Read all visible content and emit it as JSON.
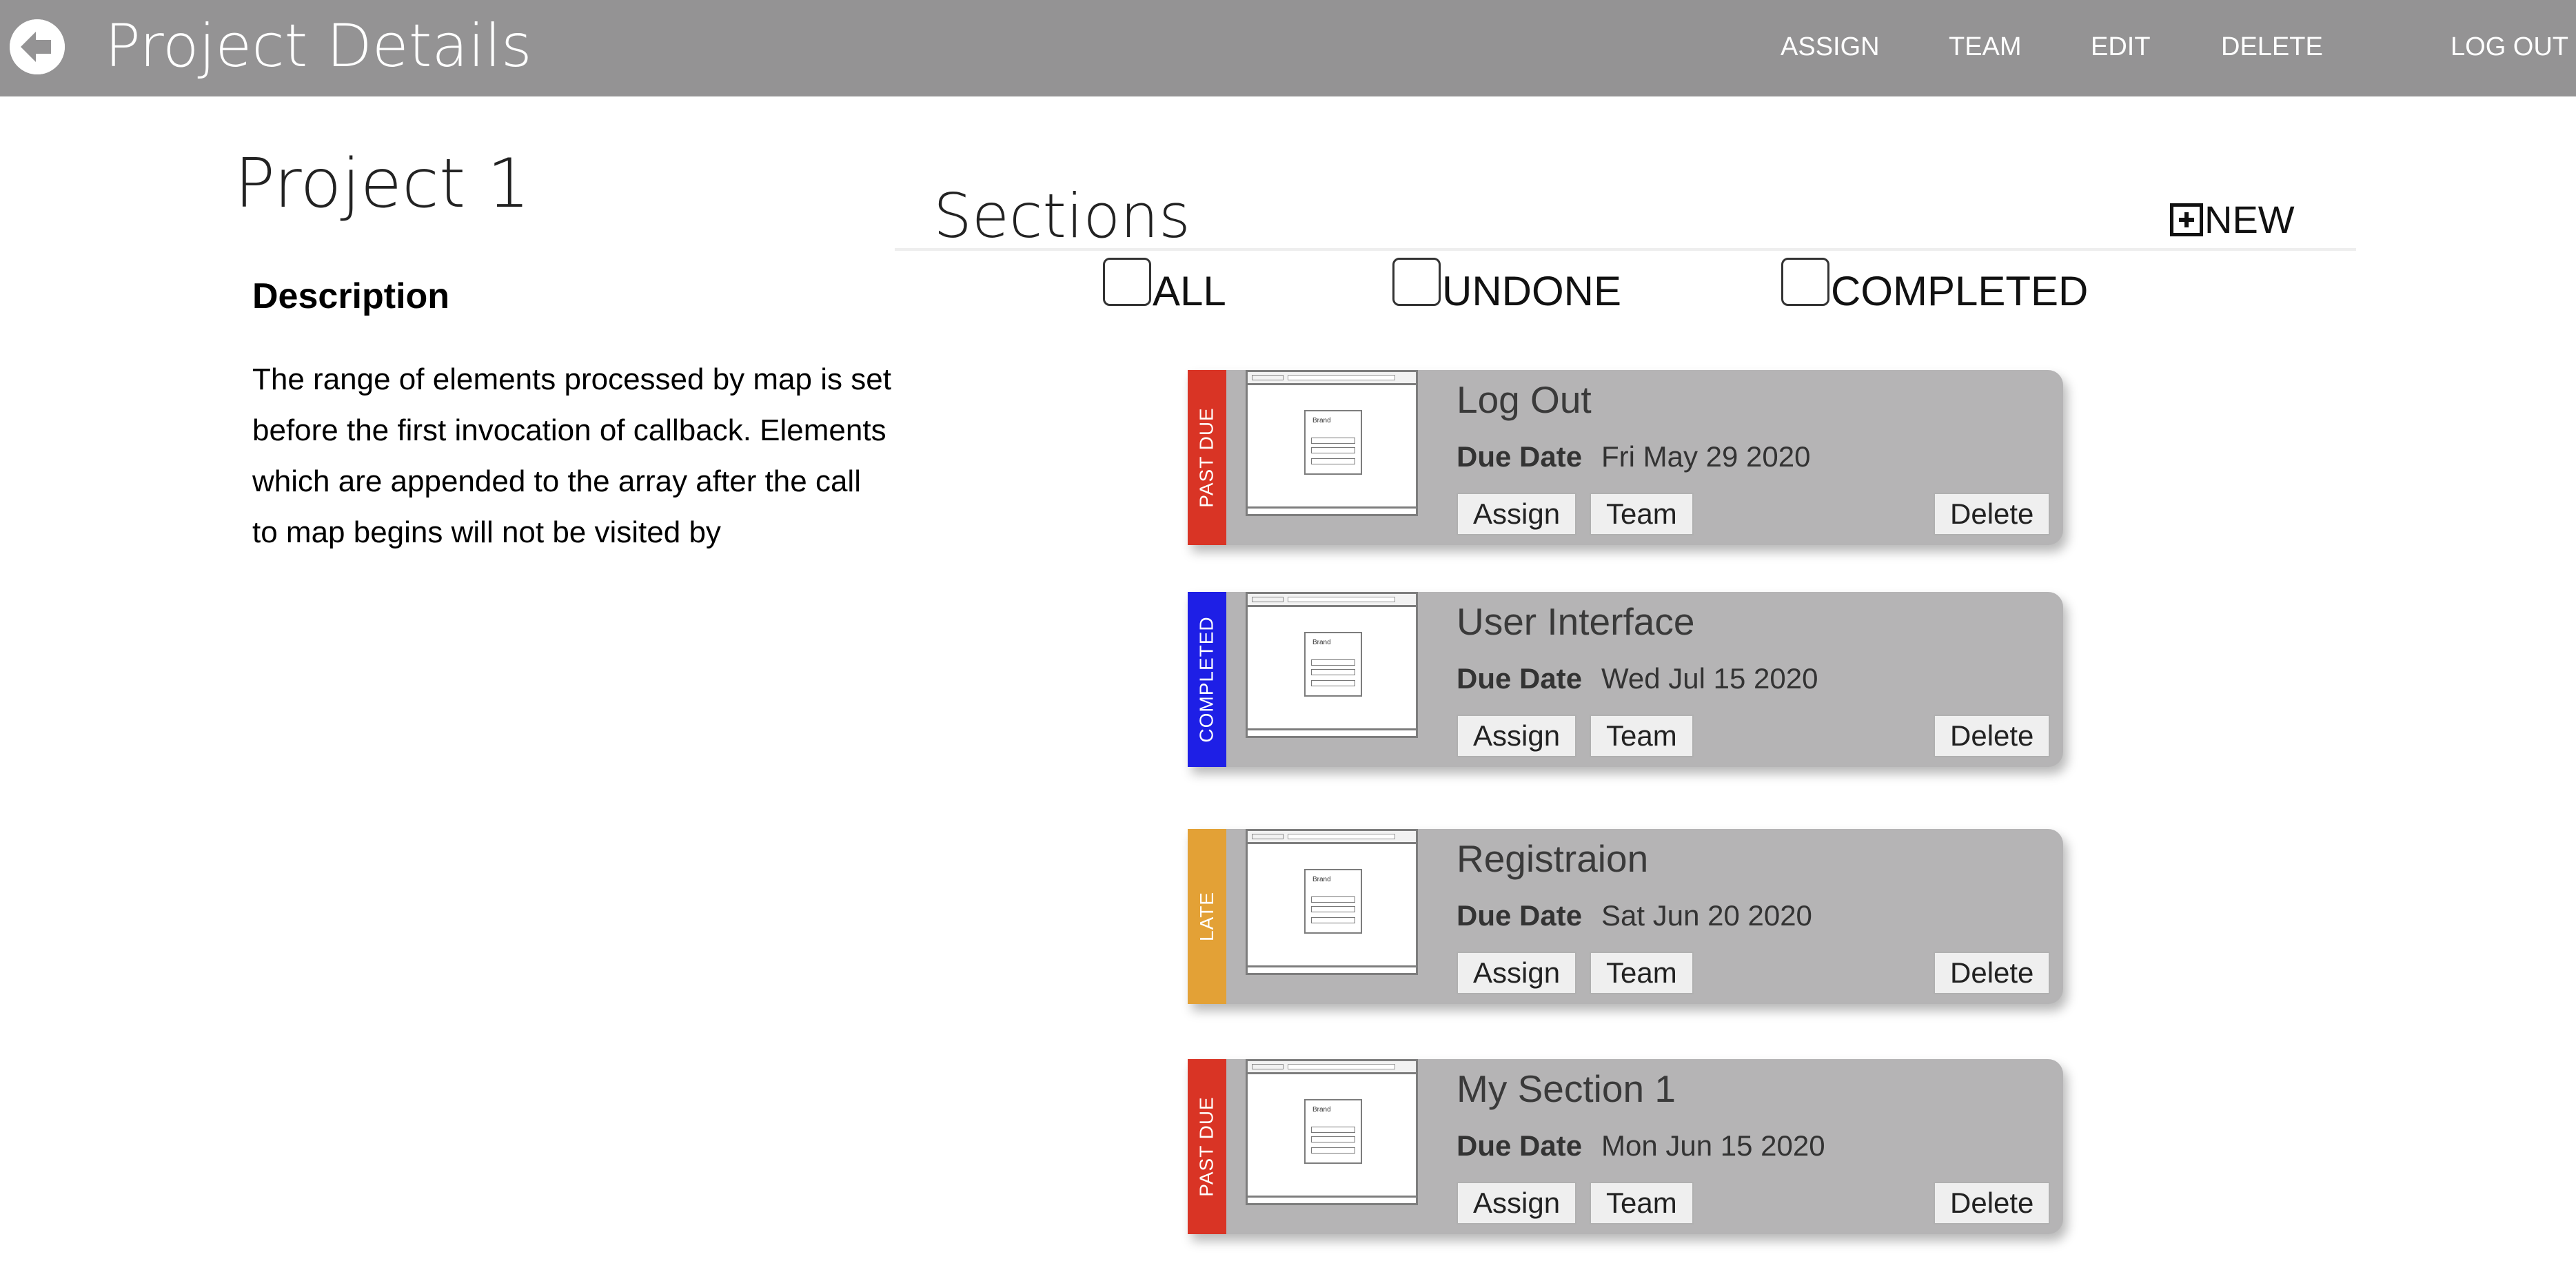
{
  "header": {
    "title": "Project Details",
    "back_icon": "arrow-left-circle-icon",
    "nav": [
      "ASSIGN",
      "TEAM",
      "EDIT",
      "DELETE",
      "LOG OUT"
    ]
  },
  "project": {
    "title": "Project 1",
    "description_heading": "Description",
    "description": "The range of elements processed by map is set before the first invocation of callback. Elements which are appended to the array after the call to map begins will not be visited by"
  },
  "sections": {
    "title": "Sections",
    "new_label": "NEW",
    "new_icon": "plus-square-icon",
    "filters": [
      "ALL",
      "UNDONE",
      "COMPLETED"
    ],
    "due_label": "Due Date",
    "actions": {
      "assign": "Assign",
      "team": "Team",
      "delete": "Delete"
    },
    "thumbnail_brand": "Brand",
    "cards": [
      {
        "title": "Log Out",
        "status": "PAST DUE",
        "status_color": "#d93425",
        "due_date": "Fri May 29 2020"
      },
      {
        "title": "User Interface",
        "status": "COMPLETED",
        "status_color": "#1e1fe6",
        "due_date": "Wed Jul 15 2020"
      },
      {
        "title": "Registraion",
        "status": "LATE",
        "status_color": "#e3a136",
        "due_date": "Sat Jun 20 2020"
      },
      {
        "title": "My Section 1",
        "status": "PAST DUE",
        "status_color": "#d93425",
        "due_date": "Mon Jun 15 2020"
      }
    ]
  },
  "colors": {
    "header_bg": "#949394",
    "card_bg": "#b5b4b5"
  }
}
